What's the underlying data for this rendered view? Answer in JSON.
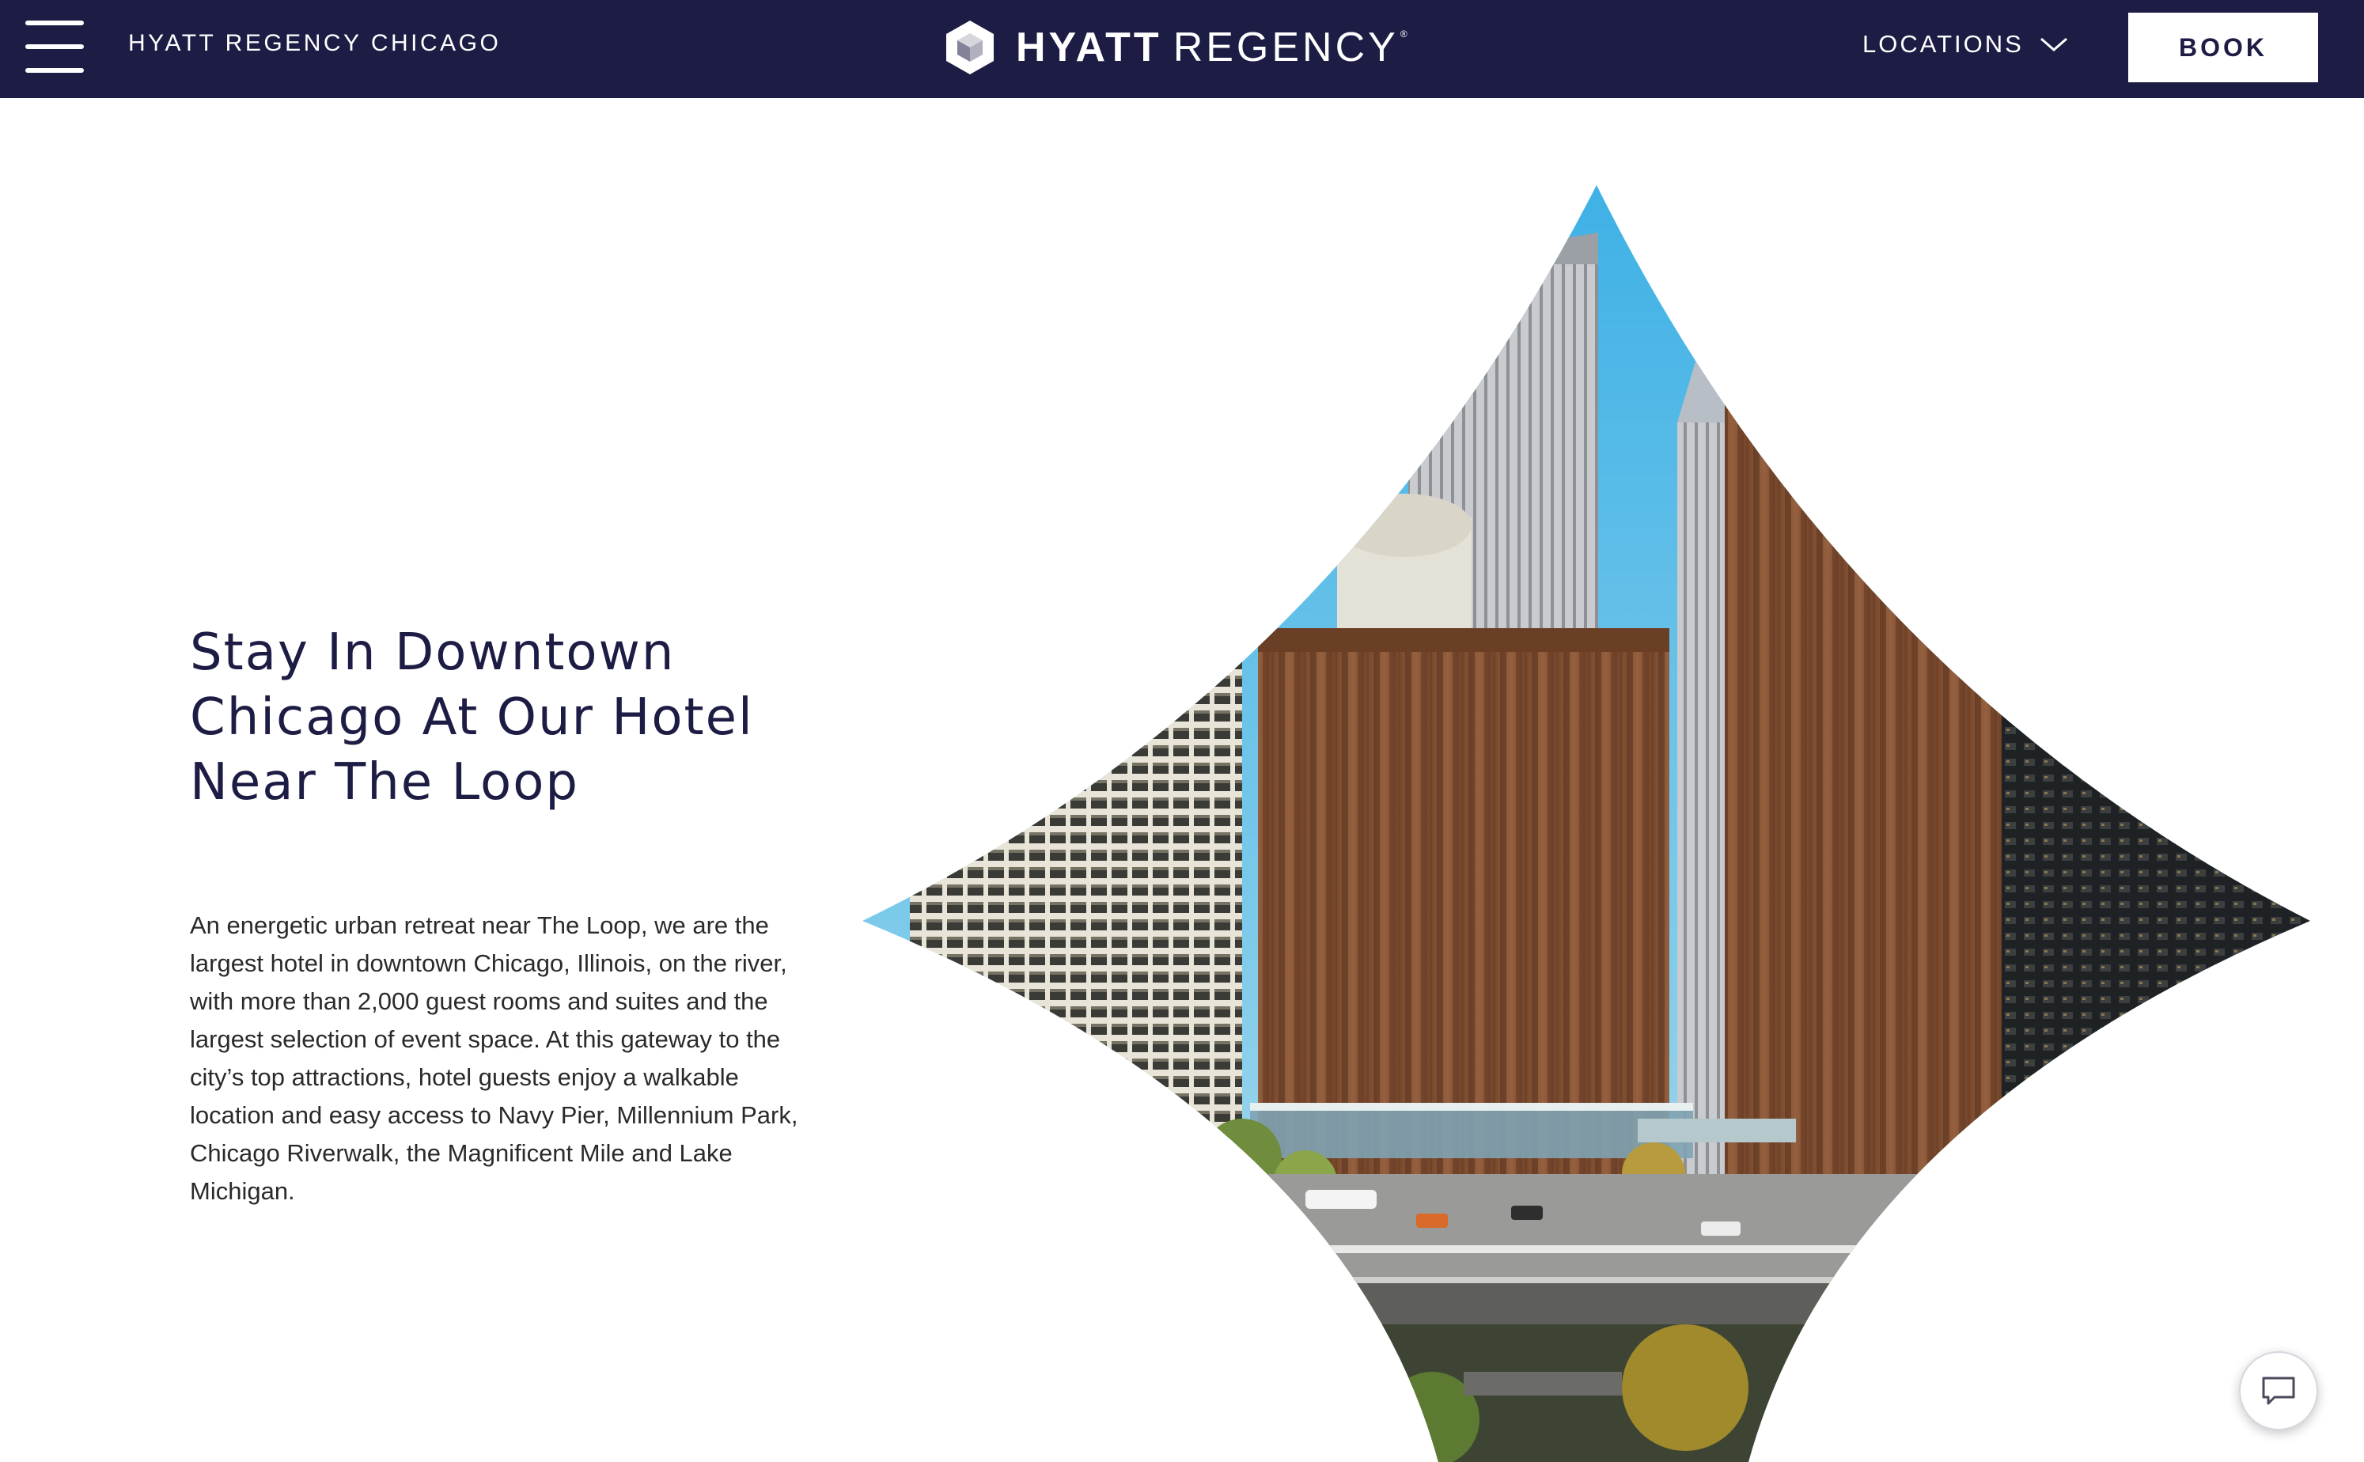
{
  "header": {
    "hotel_name": "HYATT REGENCY CHICAGO",
    "brand_primary": "HYATT",
    "brand_secondary": "REGENCY",
    "brand_mark": "®",
    "locations_label": "LOCATIONS",
    "book_label": "BOOK",
    "menu_icon": "hamburger-menu-icon",
    "dropdown_icon": "chevron-down-icon"
  },
  "main": {
    "headline_lines": [
      "Stay In Downtown",
      "Chicago At Our Hotel",
      "Near The Loop"
    ],
    "intro": "An energetic urban retreat near The Loop, we are the largest hotel in downtown Chicago, Illinois, on the river, with more than 2,000 guest rooms and suites and the largest selection of event space. At this gateway to the city’s top attractions, hotel guests enjoy a walkable location and easy access to Navy Pier, Millennium Park, Chicago Riverwalk, the Magnificent Mile and Lake Michigan."
  },
  "chat": {
    "icon": "chat-bubble-icon"
  },
  "colors": {
    "header_bg": "#1c1c44",
    "headline": "#1c1c44",
    "body_text": "#2a2a2a",
    "sky": "#5cbde6",
    "brick": "#8b5535"
  }
}
